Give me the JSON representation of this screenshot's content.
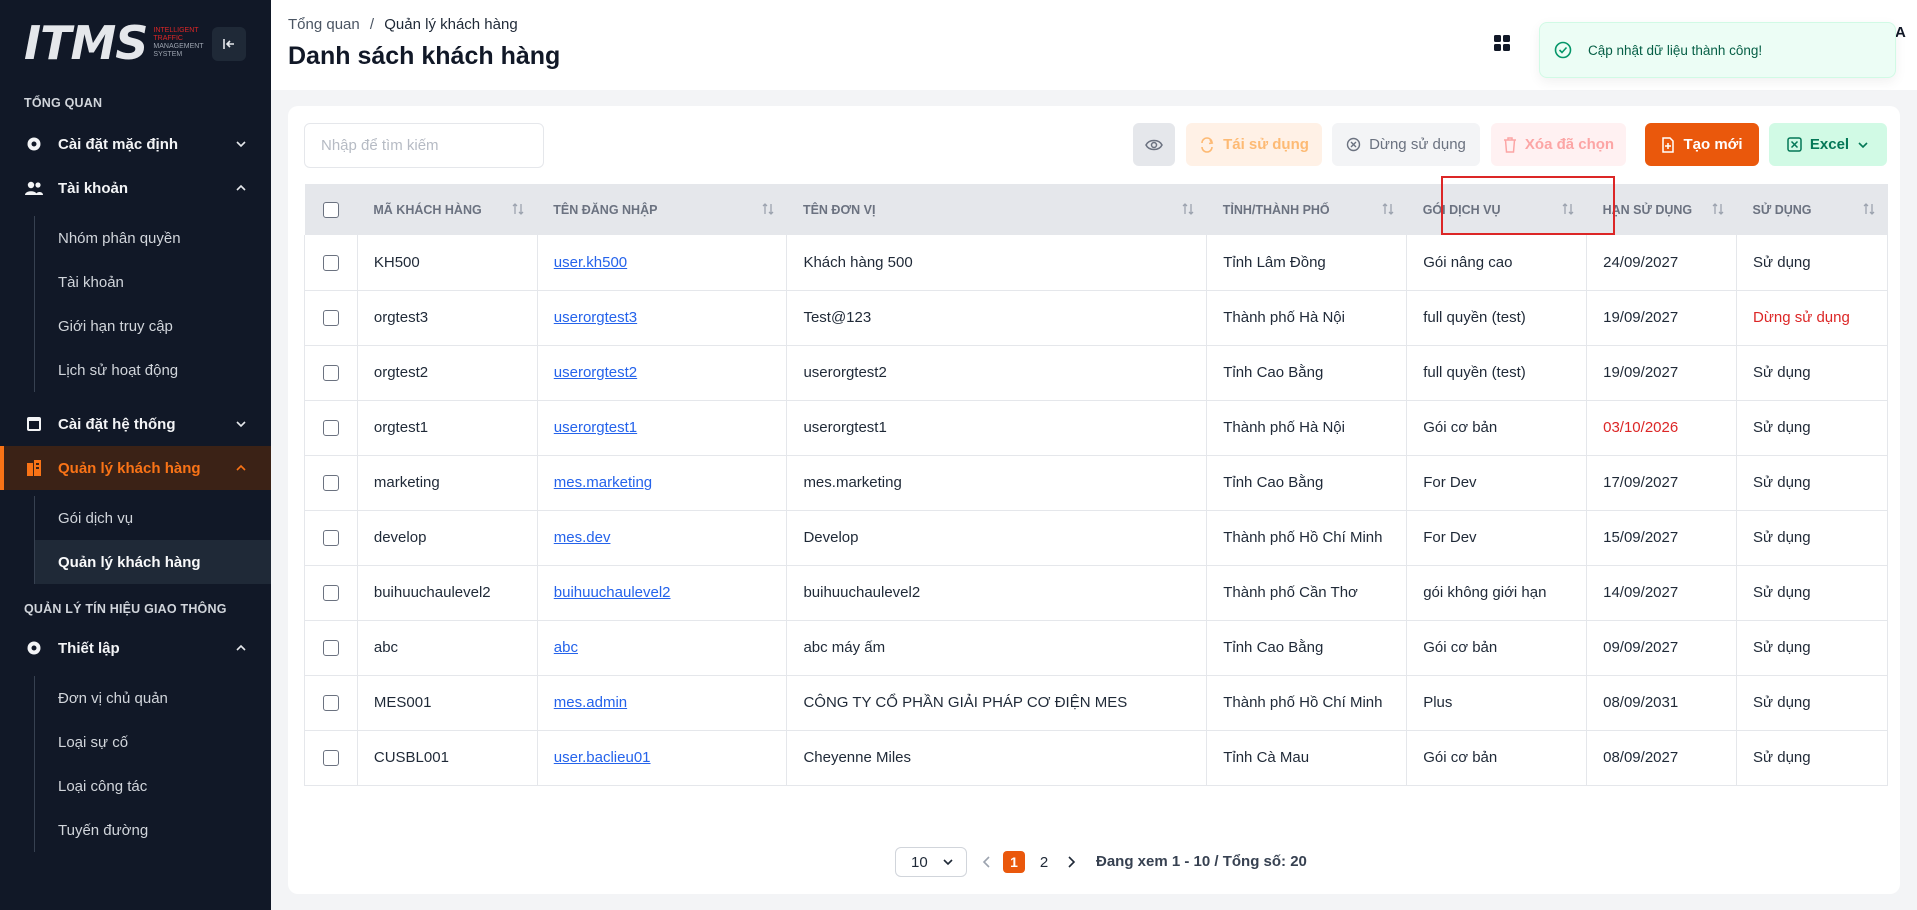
{
  "sidebar": {
    "logo_text": "ITMS",
    "logo_sub": [
      "INTELLIGENT",
      "TRAFFIC",
      "MANAGEMENT",
      "SYSTEM"
    ],
    "section_overview": "TỔNG QUAN",
    "menu_default": "Cài đặt mặc định",
    "menu_account": "Tài khoản",
    "account_items": [
      "Nhóm phân quyền",
      "Tài khoản",
      "Giới hạn truy cập",
      "Lịch sử hoạt động"
    ],
    "menu_system": "Cài đặt hệ thống",
    "menu_customers": "Quản lý khách hàng",
    "customer_items": [
      "Gói dịch vụ",
      "Quản lý khách hàng"
    ],
    "section_traffic": "QUẢN LÝ TÍN HIỆU GIAO THÔNG",
    "menu_setup": "Thiết lập",
    "setup_items": [
      "Đơn vị chủ quản",
      "Loại sự cố",
      "Loại công tác",
      "Tuyến đường"
    ]
  },
  "header": {
    "breadcrumb_root": "Tổng quan",
    "breadcrumb_sep": "/",
    "breadcrumb_current": "Quản lý khách hàng",
    "title": "Danh sách khách hàng",
    "avatar_initial": "A"
  },
  "toast": {
    "message": "Cập nhật dữ liệu thành công!"
  },
  "toolbar": {
    "search_placeholder": "Nhập để tìm kiếm",
    "reuse": "Tái sử dụng",
    "stop": "Dừng sử dụng",
    "delete": "Xóa đã chọn",
    "create": "Tạo mới",
    "excel": "Excel"
  },
  "table": {
    "columns": [
      "MÃ KHÁCH HÀNG",
      "TÊN ĐĂNG NHẬP",
      "TÊN ĐƠN VỊ",
      "TỈNH/THÀNH PHỐ",
      "GÓI DỊCH VỤ",
      "HẠN SỬ DỤNG",
      "SỬ DỤNG"
    ],
    "rows": [
      {
        "code": "KH500",
        "username": "user.kh500",
        "unit": "Khách hàng 500",
        "province": "Tỉnh Lâm Đồng",
        "package": "Gói nâng cao",
        "expiry": "24/09/2027",
        "status": "Sử dụng"
      },
      {
        "code": "orgtest3",
        "username": "userorgtest3",
        "unit": "Test@123",
        "province": "Thành phố Hà Nội",
        "package": "full quyền (test)",
        "expiry": "19/09/2027",
        "status": "Dừng sử dụng"
      },
      {
        "code": "orgtest2",
        "username": "userorgtest2",
        "unit": "userorgtest2",
        "province": "Tỉnh Cao Bằng",
        "package": "full quyền (test)",
        "expiry": "19/09/2027",
        "status": "Sử dụng"
      },
      {
        "code": "orgtest1",
        "username": "userorgtest1",
        "unit": "userorgtest1",
        "province": "Thành phố Hà Nội",
        "package": "Gói cơ bản",
        "expiry": "03/10/2026",
        "status": "Sử dụng"
      },
      {
        "code": "marketing",
        "username": "mes.marketing",
        "unit": "mes.marketing",
        "province": "Tỉnh Cao Bằng",
        "package": "For Dev",
        "expiry": "17/09/2027",
        "status": "Sử dụng"
      },
      {
        "code": "develop",
        "username": "mes.dev",
        "unit": "Develop",
        "province": "Thành phố Hồ Chí Minh",
        "package": "For Dev",
        "expiry": "15/09/2027",
        "status": "Sử dụng"
      },
      {
        "code": "buihuuchaulevel2",
        "username": "buihuuchaulevel2",
        "unit": "buihuuchaulevel2",
        "province": "Thành phố Cần Thơ",
        "package": "gói không giới hạn",
        "expiry": "14/09/2027",
        "status": "Sử dụng"
      },
      {
        "code": "abc",
        "username": "abc",
        "unit": "abc máy ấm",
        "province": "Tỉnh Cao Bằng",
        "package": "Gói cơ bản",
        "expiry": "09/09/2027",
        "status": "Sử dụng"
      },
      {
        "code": "MES001",
        "username": "mes.admin",
        "unit": "CÔNG TY CỔ PHẦN GIẢI PHÁP CƠ ĐIỆN MES",
        "province": "Thành phố Hồ Chí Minh",
        "package": "Plus",
        "expiry": "08/09/2031",
        "status": "Sử dụng"
      },
      {
        "code": "CUSBL001",
        "username": "user.baclieu01",
        "unit": "Cheyenne Miles",
        "province": "Tỉnh Cà Mau",
        "package": "Gói cơ bản",
        "expiry": "08/09/2027",
        "status": "Sử dụng"
      }
    ]
  },
  "pagination": {
    "page_size": "10",
    "pages": [
      "1",
      "2"
    ],
    "current_page": "1",
    "info": "Đang xem 1 - 10 / Tổng số: 20"
  },
  "colors": {
    "accent": "#ea580c",
    "link": "#2563eb",
    "danger": "#dc2626",
    "sidebar_bg": "#111827"
  }
}
